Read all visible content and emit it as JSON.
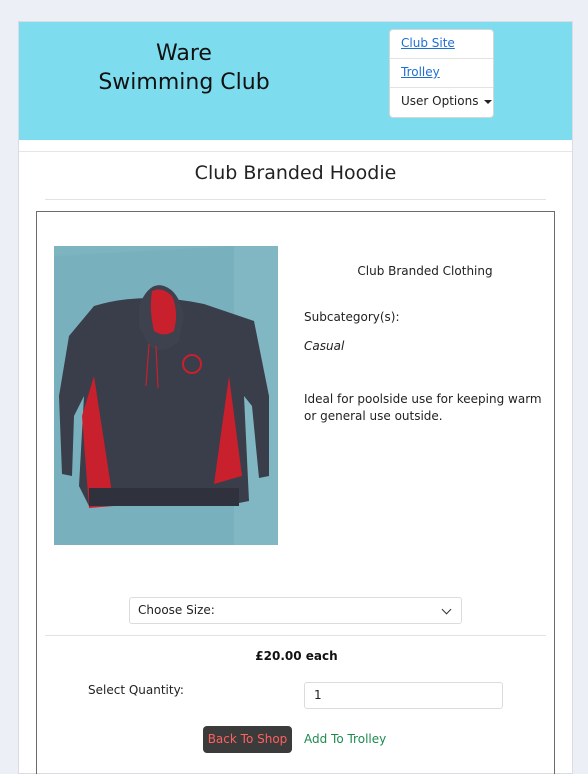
{
  "header": {
    "brand_line1": "Ware",
    "brand_line2": "Swimming Club",
    "menu": {
      "club_site": "Club Site",
      "trolley": "Trolley",
      "user_options": "User Options"
    }
  },
  "product": {
    "title": "Club Branded Hoodie",
    "category": "Club Branded Clothing",
    "subcategory_label": "Subcategory(s):",
    "subcategory_value": "Casual",
    "description": "Ideal for poolside use for keeping warm or general use outside.",
    "size_select": "Choose Size:",
    "price": "£20.00 each",
    "quantity_label": "Select Quantity:",
    "quantity_value": "1",
    "back_button": "Back To Shop",
    "add_button": "Add To Trolley"
  },
  "colors": {
    "header_bg": "#7edcef",
    "link": "#1f6fd1",
    "back_button_bg": "#3b3b3b",
    "back_button_text": "#ff6060",
    "add_button_text": "#1d8a4f",
    "hoodie_body": "#3a3d4a",
    "hoodie_accent": "#c8202c"
  },
  "icons": {
    "user_options": "caret-down-icon",
    "size_select": "chevron-down-icon"
  }
}
